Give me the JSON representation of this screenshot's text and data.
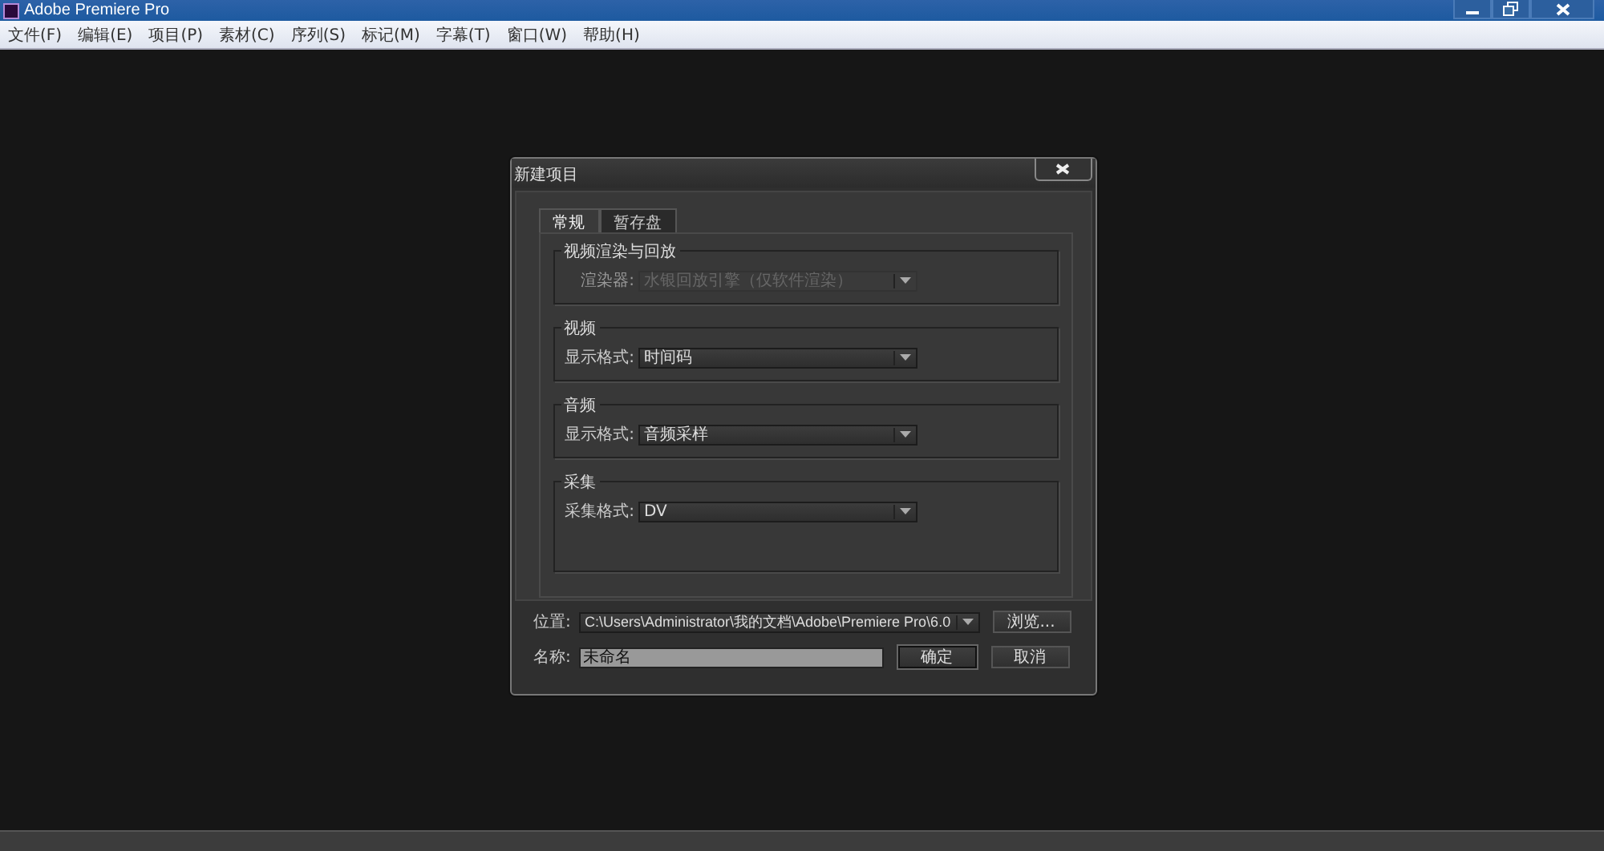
{
  "window": {
    "title": "Adobe Premiere Pro"
  },
  "menu": [
    "文件(F)",
    "编辑(E)",
    "项目(P)",
    "素材(C)",
    "序列(S)",
    "标记(M)",
    "字幕(T)",
    "窗口(W)",
    "帮助(H)"
  ],
  "dialog": {
    "title": "新建项目",
    "tabs": [
      {
        "label": "常规",
        "selected": true
      },
      {
        "label": "暂存盘",
        "selected": false
      }
    ],
    "groups": [
      {
        "title": "视频渲染与回放",
        "field": {
          "label": "渲染器:",
          "value": "水银回放引擎（仅软件渲染）",
          "disabled": true
        }
      },
      {
        "title": "视频",
        "field": {
          "label": "显示格式:",
          "value": "时间码",
          "disabled": false
        }
      },
      {
        "title": "音频",
        "field": {
          "label": "显示格式:",
          "value": "音频采样",
          "disabled": false
        }
      },
      {
        "title": "采集",
        "field": {
          "label": "采集格式:",
          "value": "DV",
          "disabled": false
        }
      }
    ],
    "location": {
      "label": "位置:",
      "value": "C:\\Users\\Administrator\\我的文档\\Adobe\\Premiere Pro\\6.0"
    },
    "browse_button": "浏览...",
    "name": {
      "label": "名称:",
      "value": "未命名"
    },
    "buttons": [
      {
        "label": "确定",
        "selected": true
      },
      {
        "label": "取消",
        "selected": false
      }
    ]
  }
}
